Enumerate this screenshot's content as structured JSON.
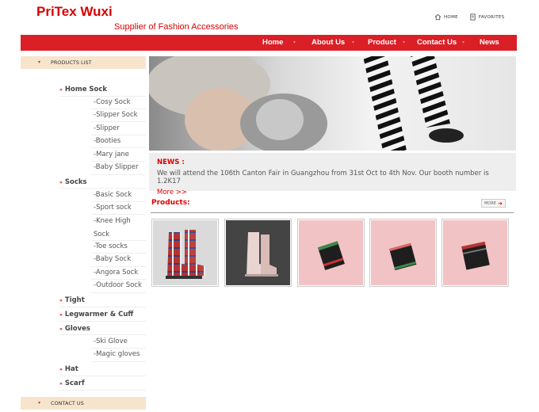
{
  "header": {
    "logo": "PriTex Wuxi",
    "tagline": "Supplier of Fashion Accessories",
    "home_link": "HOME",
    "favorites_link": "FAVORITES"
  },
  "nav": [
    "Home",
    "About Us",
    "Product",
    "Contact Us",
    "News"
  ],
  "sidebar": {
    "products_heading": "PRODUCTS LIST",
    "contact_heading": "CONTACT US",
    "categories": [
      {
        "label": "Home Sock",
        "items": [
          "-Cosy Sock",
          "-Slipper Sock",
          "-Slipper",
          "-Booties",
          "-Mary jane",
          "-Baby Slipper"
        ]
      },
      {
        "label": "Socks",
        "items": [
          "-Basic Sock",
          "-Sport sock",
          "-Knee High Sock",
          "-Toe socks",
          "-Baby Sock",
          "-Angora Sock",
          "-Outdoor Sock"
        ]
      },
      {
        "label": "Tight",
        "items": []
      },
      {
        "label": "Legwarmer & Cuff",
        "items": []
      },
      {
        "label": "Gloves",
        "items": [
          "-Ski Glove",
          "-Magic gloves"
        ]
      },
      {
        "label": "Hat",
        "items": []
      },
      {
        "label": "Scarf",
        "items": []
      }
    ]
  },
  "news": {
    "title": "NEWS :",
    "text": "We will attend the 106th Canton Fair in Guangzhou from 31st Oct to 4th Nov. Our booth number is 1.2K17",
    "more": "More >>"
  },
  "products": {
    "title": "Products:",
    "more_label": "MORE"
  },
  "colors": {
    "brand_red": "#da1f26",
    "sidebar_header": "#f7e4cc"
  }
}
